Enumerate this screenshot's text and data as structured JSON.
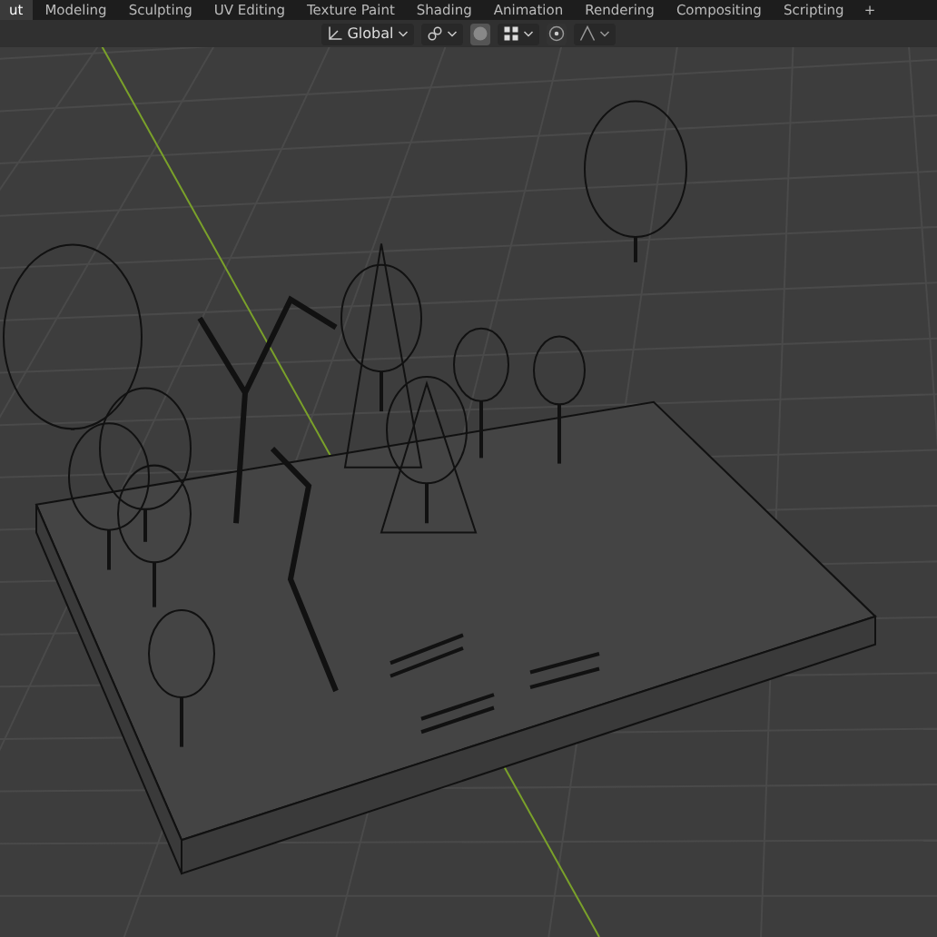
{
  "workspace_tabs": [
    {
      "label": "ut",
      "selected": true
    },
    {
      "label": "Modeling",
      "selected": false
    },
    {
      "label": "Sculpting",
      "selected": false
    },
    {
      "label": "UV Editing",
      "selected": false
    },
    {
      "label": "Texture Paint",
      "selected": false
    },
    {
      "label": "Shading",
      "selected": false
    },
    {
      "label": "Animation",
      "selected": false
    },
    {
      "label": "Rendering",
      "selected": false
    },
    {
      "label": "Compositing",
      "selected": false
    },
    {
      "label": "Scripting",
      "selected": false
    }
  ],
  "add_tab": "+",
  "header": {
    "transform_orientation": "Global",
    "proportional_editing": false
  }
}
